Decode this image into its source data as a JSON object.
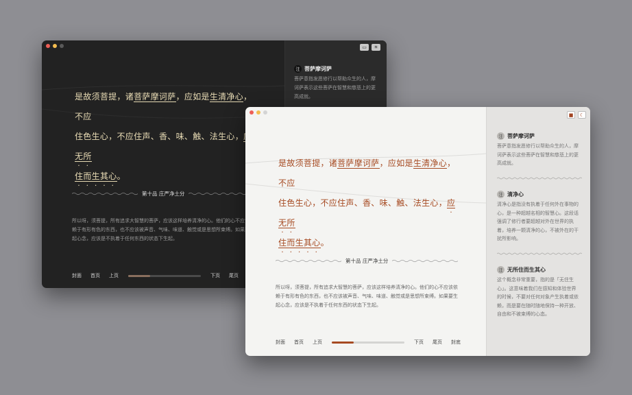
{
  "verse": {
    "p1": "是故须菩提，诸",
    "term1": "菩萨摩诃萨",
    "p2": "，应如是",
    "term2": "生清净心",
    "p3": "，不应",
    "p4": "住色生心，不应住声、香、味、触、法生心，",
    "term3": "应无所",
    "term3b": "住而生其心",
    "p5": "。"
  },
  "section_title": "第十品 庄严净土分",
  "paragraph": "所以呀，须菩提，所有追求大智慧的菩萨，应该这样培养清净的心。他们的心不应该依赖于有形有色的东西，也不应该被声音、气味、味道、触觉或是思想所束缚。如果要生起心念，应该是不执着于任何东西的状态下生起。",
  "nav": {
    "cover": "封面",
    "first": "首页",
    "prev": "上页",
    "next": "下页",
    "last": "尾页",
    "back_cover": "封底",
    "progress": 0.3
  },
  "dark_notes": {
    "badge": "注",
    "title": "菩萨摩诃萨",
    "body": "菩萨意指发愿修行以帮助众生的人，摩诃萨表示这些菩萨在智慧和慈悲上的更高成就。"
  },
  "light_notes": [
    {
      "badge": "注",
      "title": "菩萨摩诃萨",
      "body": "菩萨意指发愿修行以帮助众生的人，摩诃萨表示这些菩萨在智慧和慈悲上的更高成就。"
    },
    {
      "badge": "注",
      "title": "清净心",
      "body": "清净心是指没有执着于任何外在事物的心，是一种超越名相的智慧心。这段话强调了修行者要超越对外在世界的执着，培养一颗清净的心，不被外在的干扰所影响。"
    },
    {
      "badge": "注",
      "title": "无所住而生其心",
      "body": "这个概念非常重要，指的是「无住生心」。这意味着我们在感知和体验世界的时候，不要对任何对象产生执着或依赖，而是要在随时随地保持一种开放、自由和不被束缚的心态。"
    }
  ],
  "colors": {
    "dark_accent": "#e9dcb5",
    "light_accent": "#a64a22",
    "progress_fill_dark": "#8a6f5e",
    "progress_fill_light": "#a64a22"
  },
  "icons": {
    "layout": "sidebar-toggle-icon",
    "theme_dark": "sun-icon",
    "theme_light": "moon-icon"
  }
}
